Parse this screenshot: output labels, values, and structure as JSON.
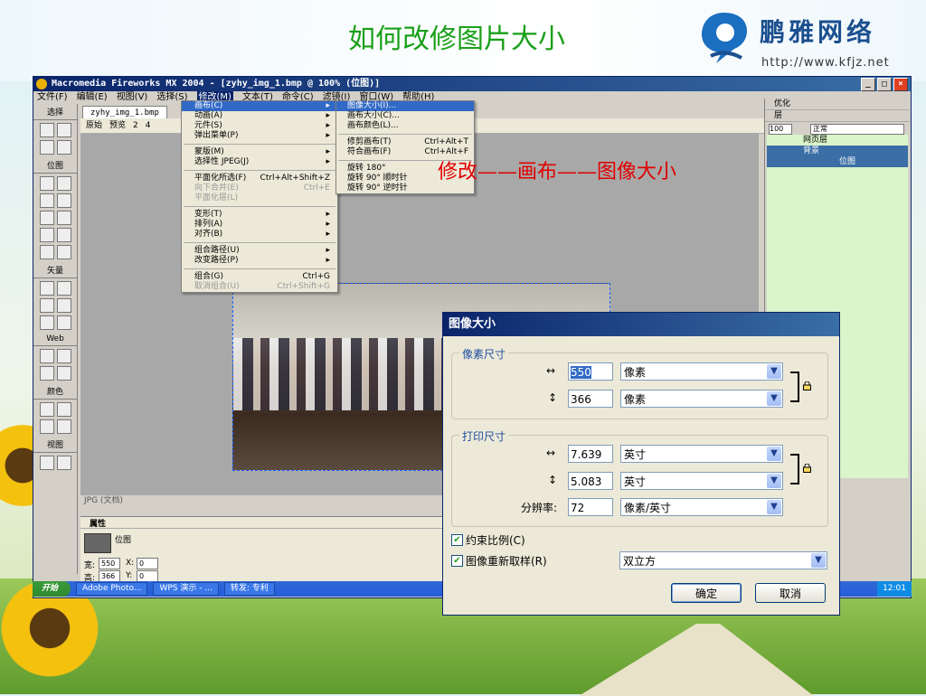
{
  "slide": {
    "title": "如何改修图片大小",
    "annotation": "修改——画布——图像大小",
    "logo_text": "鹏雅网络",
    "logo_url": "http://www.kfjz.net"
  },
  "window": {
    "title": "Macromedia Fireworks MX 2004 - [zyhy_img_1.bmp @ 100% (位图)]",
    "buttons": {
      "min": "_",
      "max": "□",
      "close": "×"
    }
  },
  "menubar": [
    "文件(F)",
    "编辑(E)",
    "视图(V)",
    "选择(S)",
    "修改(M)",
    "文本(T)",
    "命令(C)",
    "滤镜(I)",
    "窗口(W)",
    "帮助(H)"
  ],
  "tools": {
    "sections": [
      "选择",
      "位图",
      "矢量",
      "Web",
      "颜色",
      "视图"
    ]
  },
  "document": {
    "tab": "zyhy_img_1.bmp",
    "toolbar": [
      "原始",
      "预览",
      "2",
      "4"
    ],
    "footer": "JPG (文档)"
  },
  "properties": {
    "title": "属性",
    "type": "位图",
    "width_label": "宽:",
    "width": "550",
    "height_label": "高:",
    "height": "366",
    "x_label": "X:",
    "x": "0",
    "y_label": "Y:",
    "y": "0"
  },
  "right_panel": {
    "optimize": "优化",
    "layers": "层",
    "opacity": "100",
    "blend": "正常",
    "layer_items": [
      "网页层",
      "背景",
      "位图"
    ]
  },
  "modify_menu": [
    {
      "label": "画布(C)",
      "arrow": true,
      "highlight": true
    },
    {
      "label": "动画(A)",
      "arrow": true
    },
    {
      "label": "元件(S)",
      "arrow": true
    },
    {
      "label": "弹出菜单(P)",
      "arrow": true
    },
    {
      "sep": true
    },
    {
      "label": "蒙版(M)",
      "arrow": true
    },
    {
      "label": "选择性 JPEG(J)",
      "arrow": true
    },
    {
      "sep": true
    },
    {
      "label": "平面化所选(F)",
      "shortcut": "Ctrl+Alt+Shift+Z"
    },
    {
      "label": "向下合并(E)",
      "shortcut": "Ctrl+E",
      "disabled": true
    },
    {
      "label": "平面化层(L)",
      "disabled": true
    },
    {
      "sep": true
    },
    {
      "label": "变形(T)",
      "arrow": true
    },
    {
      "label": "排列(A)",
      "arrow": true
    },
    {
      "label": "对齐(B)",
      "arrow": true
    },
    {
      "sep": true
    },
    {
      "label": "组合路径(U)",
      "arrow": true
    },
    {
      "label": "改变路径(P)",
      "arrow": true
    },
    {
      "sep": true
    },
    {
      "label": "组合(G)",
      "shortcut": "Ctrl+G"
    },
    {
      "label": "取消组合(U)",
      "shortcut": "Ctrl+Shift+G",
      "disabled": true
    }
  ],
  "canvas_menu": [
    {
      "label": "图像大小(I)...",
      "highlight": true
    },
    {
      "label": "画布大小(C)..."
    },
    {
      "label": "画布颜色(L)..."
    },
    {
      "sep": true
    },
    {
      "label": "修剪画布(T)",
      "shortcut": "Ctrl+Alt+T"
    },
    {
      "label": "符合画布(F)",
      "shortcut": "Ctrl+Alt+F"
    },
    {
      "sep": true
    },
    {
      "label": "旋转 180°"
    },
    {
      "label": "旋转 90° 顺时针"
    },
    {
      "label": "旋转 90° 逆时针"
    }
  ],
  "dialog": {
    "title": "图像大小",
    "pixel_group": "像素尺寸",
    "pixel_width": "550",
    "pixel_height": "366",
    "pixel_unit": "像素",
    "print_group": "打印尺寸",
    "print_width": "7.639",
    "print_height": "5.083",
    "print_unit": "英寸",
    "resolution_label": "分辨率:",
    "resolution": "72",
    "resolution_unit": "像素/英寸",
    "width_arrow": "↔",
    "height_arrow": "↕",
    "constrain_label": "约束比例(C)",
    "constrain_checked": true,
    "resample_label": "图像重新取样(R)",
    "resample_checked": true,
    "resample_method": "双立方",
    "ok": "确定",
    "cancel": "取消"
  },
  "taskbar": {
    "start": "开始",
    "tasks": [
      "Adobe Photo...",
      "WPS 演示 - ...",
      "转发: 专利"
    ],
    "clock": "12:01"
  }
}
